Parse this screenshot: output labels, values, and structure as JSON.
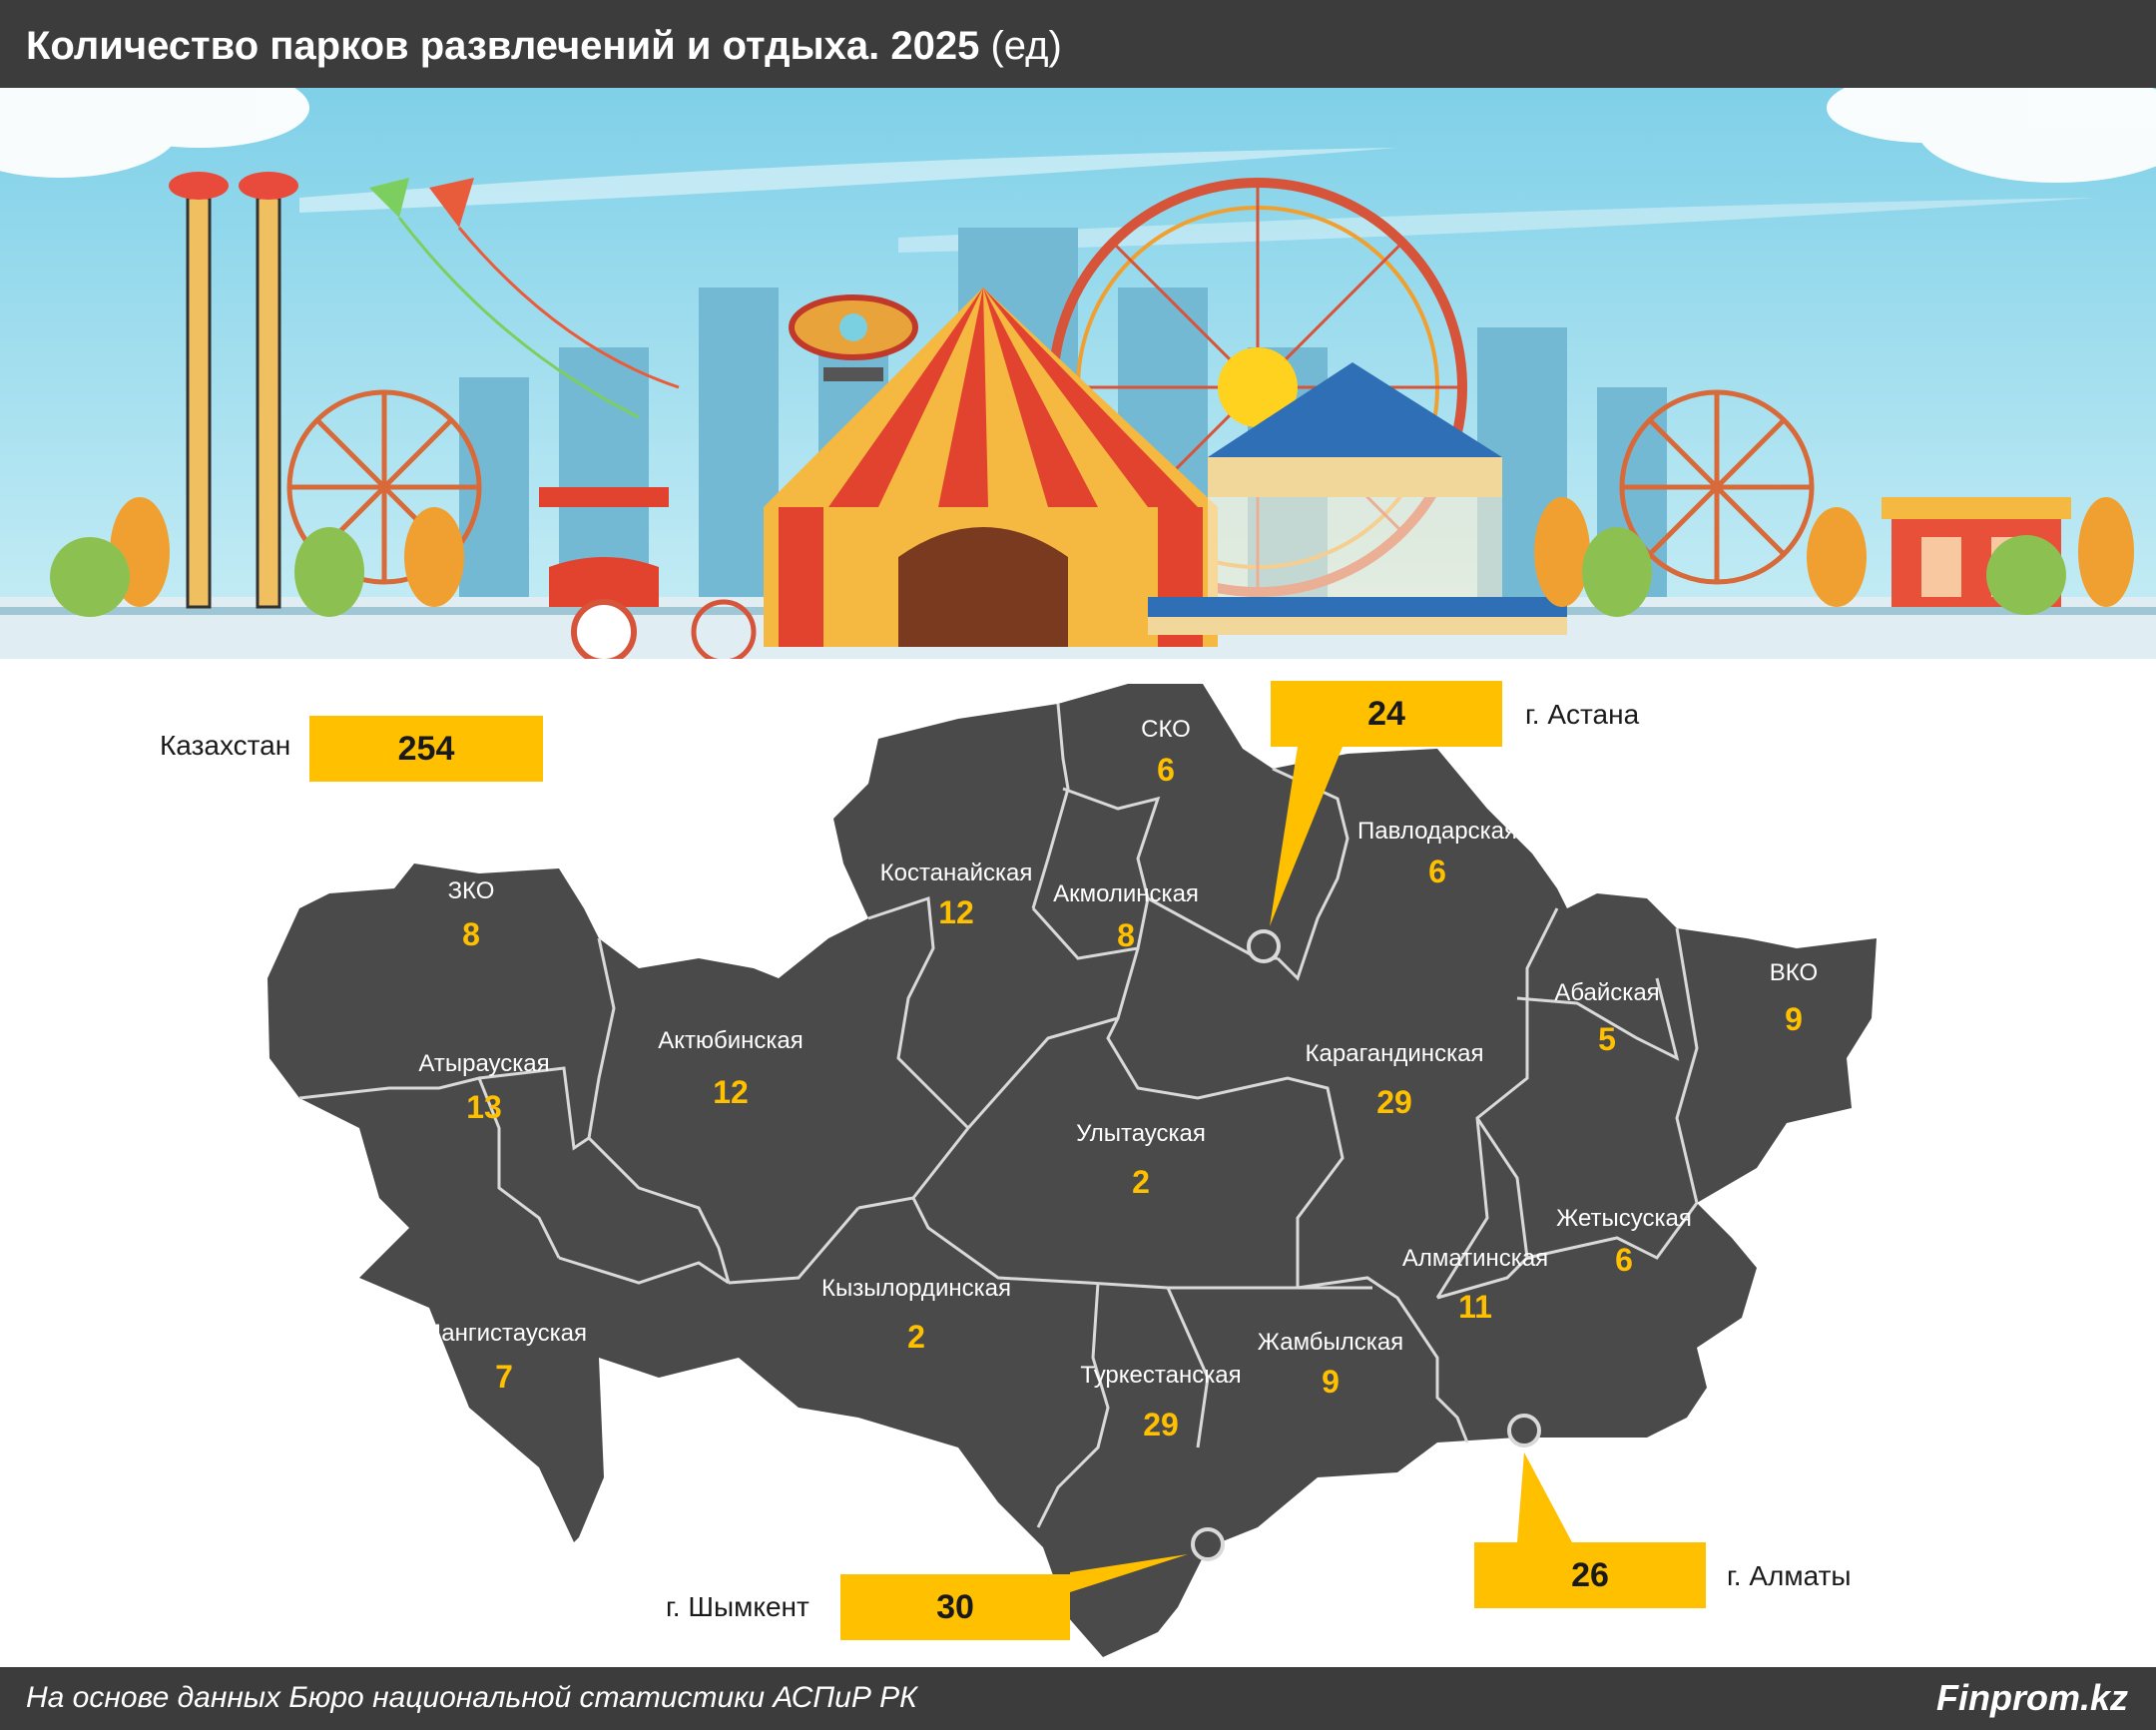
{
  "header": {
    "title_bold": "Количество парков развлечений и отдыха. 2025",
    "title_unit": "(ед)"
  },
  "total": {
    "label": "Казахстан",
    "value": "254"
  },
  "cities": {
    "astana": {
      "label": "г. Астана",
      "value": "24"
    },
    "almaty": {
      "label": "г. Алматы",
      "value": "26"
    },
    "shymkent": {
      "label": "г. Шымкент",
      "value": "30"
    }
  },
  "regions": [
    {
      "name": "СКО",
      "value": "6"
    },
    {
      "name": "Костанайская",
      "value": "12"
    },
    {
      "name": "Акмолинская",
      "value": "8"
    },
    {
      "name": "Павлодарская",
      "value": "6"
    },
    {
      "name": "ЗКО",
      "value": "8"
    },
    {
      "name": "Атырауская",
      "value": "13"
    },
    {
      "name": "Актюбинская",
      "value": "12"
    },
    {
      "name": "Абайская",
      "value": "5"
    },
    {
      "name": "ВКО",
      "value": "9"
    },
    {
      "name": "Карагандинская",
      "value": "29"
    },
    {
      "name": "Улытауская",
      "value": "2"
    },
    {
      "name": "Жетысуская",
      "value": "6"
    },
    {
      "name": "Алматинская",
      "value": "11"
    },
    {
      "name": "Кызылординская",
      "value": "2"
    },
    {
      "name": "Мангистауская",
      "value": "7"
    },
    {
      "name": "Жамбылская",
      "value": "9"
    },
    {
      "name": "Туркестанская",
      "value": "29"
    }
  ],
  "colors": {
    "map_fill": "#4a4a4a",
    "border": "#d9d9d9",
    "accent": "#ffc000",
    "bar": "#3c3c3c"
  },
  "footer": {
    "source": "На основе данных Бюро национальной статистики АСПиР РК",
    "brand": "Finprom.kz"
  }
}
